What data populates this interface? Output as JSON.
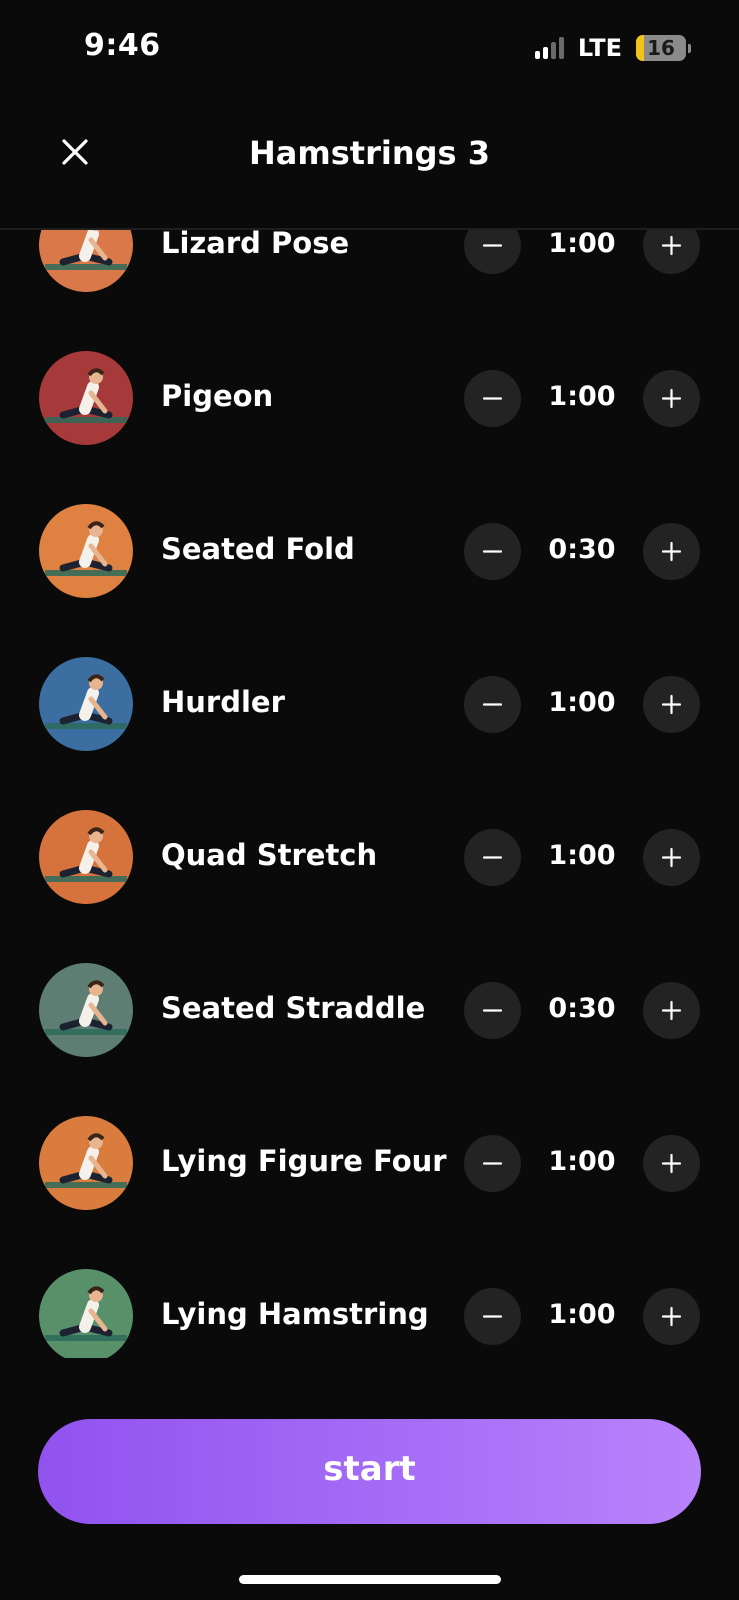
{
  "status_bar": {
    "time": "9:46",
    "network": "LTE",
    "battery": "16",
    "battery_level": 0.16,
    "signal_bars_active": 2
  },
  "header": {
    "title": "Hamstrings 3",
    "close_icon": "close-icon"
  },
  "stretches": [
    {
      "name": "Lizard Pose",
      "duration": "1:00",
      "color": "#d9794a"
    },
    {
      "name": "Pigeon",
      "duration": "1:00",
      "color": "#a6393a"
    },
    {
      "name": "Seated Fold",
      "duration": "0:30",
      "color": "#de8141"
    },
    {
      "name": "Hurdler",
      "duration": "1:00",
      "color": "#3d6ea1"
    },
    {
      "name": "Quad Stretch",
      "duration": "1:00",
      "color": "#d6733c"
    },
    {
      "name": "Seated Straddle",
      "duration": "0:30",
      "color": "#5e7e73"
    },
    {
      "name": "Lying Figure Four",
      "duration": "1:00",
      "color": "#d97c3e"
    },
    {
      "name": "Lying Hamstring",
      "duration": "1:00",
      "color": "#58906a"
    }
  ],
  "icons": {
    "minus": "minus-icon",
    "plus": "plus-icon"
  },
  "start_button": {
    "label": "start",
    "gradient_start": "#9152ee",
    "gradient_end": "#b882fb"
  }
}
